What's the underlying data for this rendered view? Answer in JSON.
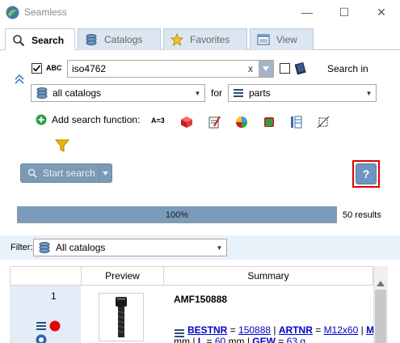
{
  "window": {
    "title": "Seamless",
    "minimize": "—",
    "maximize": "☐",
    "close": "✕"
  },
  "tabs": [
    {
      "label": "Search",
      "active": true
    },
    {
      "label": "Catalogs",
      "active": false
    },
    {
      "label": "Favorites",
      "active": false
    },
    {
      "label": "View",
      "active": false
    }
  ],
  "search": {
    "abc_label": "ABC",
    "query": "iso4762",
    "clear": "x",
    "search_in_label": "Search in",
    "catalog_value": "all catalogs",
    "for_label": "for",
    "for_value": "parts",
    "add_function_label": "Add search function:",
    "a3_label": "A=3",
    "start_label": "Start search",
    "help_label": "?"
  },
  "progress": {
    "value": 100,
    "text": "100%",
    "results": "50 results"
  },
  "filter": {
    "label": "Filter:",
    "value": "All catalogs"
  },
  "grid": {
    "columns": [
      "Preview",
      "Summary"
    ],
    "rows": [
      {
        "index": "1",
        "id": "AMF150888",
        "line1": [
          {
            "k": "BESTNR",
            "v": "150888"
          },
          {
            "k": "ARTNR",
            "v": "M12x60"
          },
          {
            "k": "M",
            "v": ""
          }
        ],
        "line2_prefix": "mm | ",
        "line2": [
          {
            "k": "L",
            "v": "60",
            "unit": " mm"
          },
          {
            "k": "GEW",
            "v": "63 g",
            "unit": ""
          }
        ]
      }
    ]
  },
  "colors": {
    "accent": "#7a9cba",
    "tab_inactive": "#dbe6f1",
    "highlight_outline": "#e00000",
    "row_band": "#e3edf7"
  }
}
